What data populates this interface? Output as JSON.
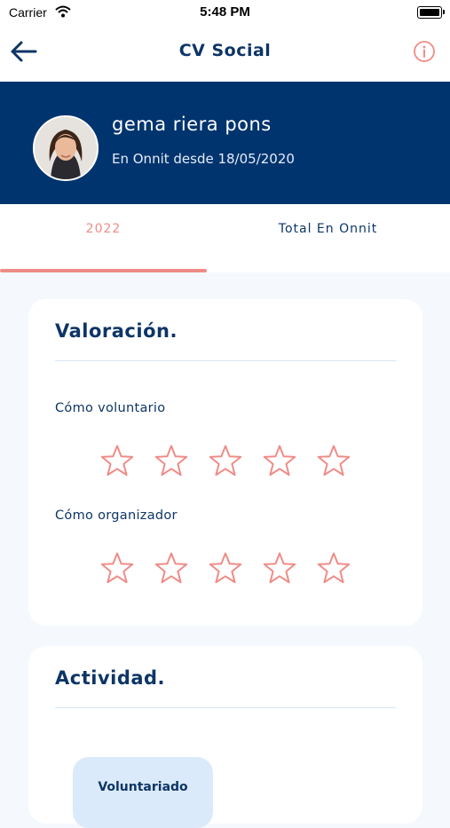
{
  "status_bar": {
    "carrier": "Carrier",
    "time": "5:48 PM"
  },
  "nav": {
    "title": "CV Social",
    "back_icon": "arrow-left-icon",
    "info_icon": "info-circle-icon"
  },
  "profile": {
    "name": "gema riera pons",
    "member_since": "En Onnit desde 18/05/2020"
  },
  "tabs": [
    {
      "label": "2022",
      "selected": true
    },
    {
      "label": "Total En Onnit",
      "selected": false
    }
  ],
  "valoracion": {
    "title": "Valoración.",
    "voluntario": {
      "label": "Cómo voluntario",
      "rating": 0,
      "max": 5
    },
    "organizador": {
      "label": "Cómo organizador",
      "rating": 0,
      "max": 5
    }
  },
  "actividad": {
    "title": "Actividad.",
    "voluntariado_label": "Voluntariado"
  },
  "colors": {
    "navy": "#00346e",
    "accent": "#ef8c87",
    "text": "#0d3566"
  }
}
